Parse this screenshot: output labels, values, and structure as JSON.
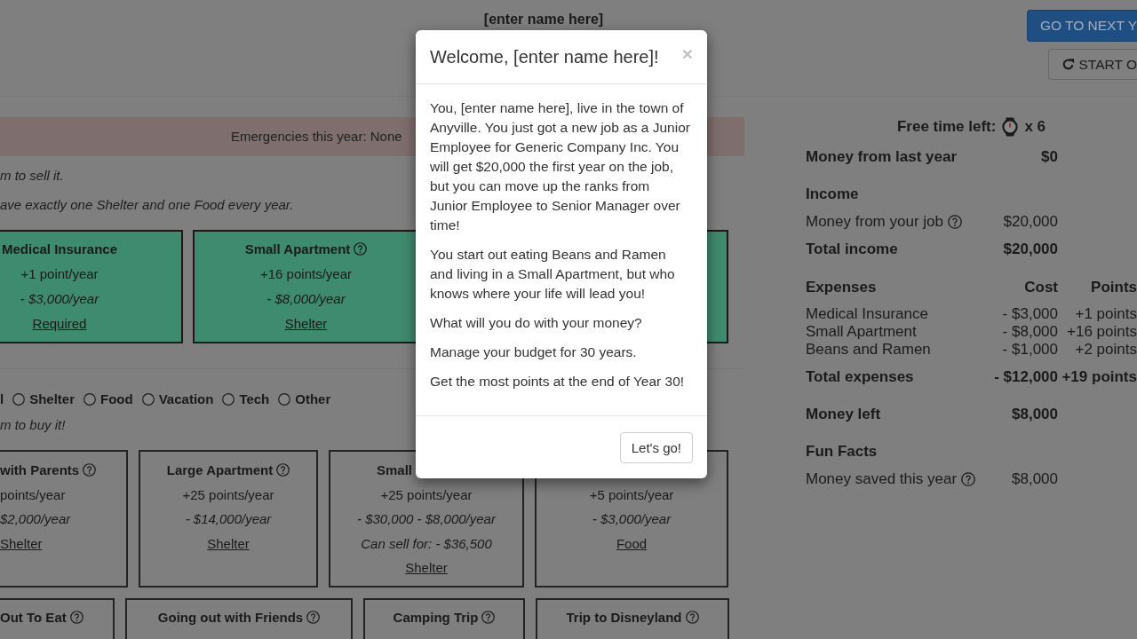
{
  "header": {
    "player_name": "[enter name here]",
    "buttons": [
      {
        "kind": "primary",
        "label": "GO TO NEXT Y"
      },
      {
        "kind": "restart",
        "label": "START O"
      }
    ]
  },
  "alert": {
    "text": "Emergencies this year: None"
  },
  "owned_section": {
    "notes": [
      "m to sell it.",
      "ave exactly one Shelter and one Food every year."
    ],
    "items": [
      {
        "title": "Medical Insurance",
        "help": false,
        "points": "+1 point/year",
        "cost": "- $3,000/year",
        "category": "Required"
      },
      {
        "title": "Small Apartment",
        "help": true,
        "points": "+16 points/year",
        "cost": "- $8,000/year",
        "category": "Shelter"
      }
    ]
  },
  "shop_section": {
    "filter_cut_label": "l",
    "filters": [
      {
        "label": "Shelter",
        "selected": false
      },
      {
        "label": "Food",
        "selected": false
      },
      {
        "label": "Vacation",
        "selected": false
      },
      {
        "label": "Tech",
        "selected": false
      },
      {
        "label": "Other",
        "selected": false
      }
    ],
    "note": "m to buy it!",
    "rows": [
      {
        "items": [
          {
            "title": "with Parents",
            "help": true,
            "points": "points/year",
            "cost": "$2,000/year",
            "category": "Shelter"
          },
          {
            "title": "Large Apartment",
            "help": true,
            "points": "+25 points/year",
            "cost": "- $14,000/year",
            "category": "Shelter"
          },
          {
            "title": "Small",
            "points": "+25 points/year",
            "cost": "- $30,000 - $8,000/year",
            "sell": "Can sell for: - $36,500",
            "category": "Shelter"
          },
          {
            "points": "+5 points/year",
            "cost": "- $3,000/year",
            "category": "Food"
          }
        ]
      },
      {
        "items": [
          {
            "title": "Out To Eat",
            "help": true
          },
          {
            "title": "Going out with Friends",
            "help": true
          },
          {
            "title": "Camping Trip",
            "help": true
          },
          {
            "title": "Trip to Disneyland",
            "help": true
          }
        ]
      }
    ]
  },
  "summary": {
    "free_time": {
      "label": "Free time left:",
      "count": "x 6"
    },
    "money_from_last_year": {
      "label": "Money from last year",
      "value": "$0"
    },
    "income": {
      "heading": "Income",
      "rows": [
        {
          "label": "Money from your job",
          "value": "$20,000",
          "help": true
        }
      ],
      "total": {
        "label": "Total income",
        "value": "$20,000"
      }
    },
    "expenses": {
      "heading": "Expenses",
      "cost_heading": "Cost",
      "points_heading": "Points",
      "rows": [
        {
          "label": "Medical Insurance",
          "cost": "- $3,000",
          "points": "+1 points"
        },
        {
          "label": "Small Apartment",
          "cost": "- $8,000",
          "points": "+16 points"
        },
        {
          "label": "Beans and Ramen",
          "cost": "- $1,000",
          "points": "+2 points"
        }
      ],
      "total": {
        "label": "Total expenses",
        "cost": "- $12,000",
        "points": "+19 points"
      }
    },
    "money_left": {
      "label": "Money left",
      "value": "$8,000"
    },
    "fun_facts": {
      "heading": "Fun Facts",
      "rows": [
        {
          "label": "Money saved this year",
          "value": "$8,000",
          "help": true
        }
      ]
    }
  },
  "modal": {
    "title": "Welcome, [enter name here]!",
    "close": "×",
    "paragraphs": [
      "You, [enter name here], live in the town of Anyville. You just got a new job as a Junior Employee for Generic Company Inc. You will get $20,000 the first year on the job, but you can move up the ranks from Junior Employee to Senior Manager over time!",
      "You start out eating Beans and Ramen and living in a Small Apartment, but who knows where your life will lead you!",
      "What will you do with your money?",
      "Manage your budget for 30 years.",
      "Get the most points at the end of Year 30!"
    ],
    "button": "Let's go!"
  }
}
